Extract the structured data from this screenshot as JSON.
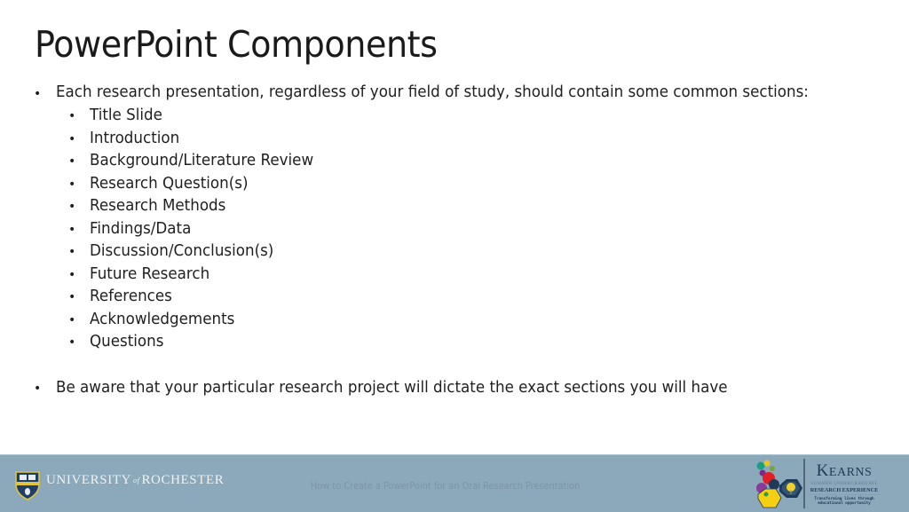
{
  "slide": {
    "title": "PowerPoint Components",
    "bullets": [
      {
        "level": 1,
        "text": "Each research presentation, regardless of your field of study, should contain some common sections:"
      },
      {
        "level": 2,
        "text": "Title Slide"
      },
      {
        "level": 2,
        "text": "Introduction"
      },
      {
        "level": 2,
        "text": "Background/Literature Review"
      },
      {
        "level": 2,
        "text": "Research Question(s)"
      },
      {
        "level": 2,
        "text": "Research Methods"
      },
      {
        "level": 2,
        "text": "Findings/Data"
      },
      {
        "level": 2,
        "text": "Discussion/Conclusion(s)"
      },
      {
        "level": 2,
        "text": "Future Research"
      },
      {
        "level": 2,
        "text": "References"
      },
      {
        "level": 2,
        "text": "Acknowledgements"
      },
      {
        "level": 2,
        "text": "Questions"
      },
      {
        "level": 1,
        "text": "Be aware that your particular research project will dictate the exact sections you will have"
      }
    ],
    "bullet_glyph": "•"
  },
  "footer": {
    "university_name_part1": "UNIVERSITY",
    "university_name_of": "of",
    "university_name_part2": "ROCHESTER",
    "presentation_title": "How to Create a PowerPoint for an Oral Research Presentation",
    "kearns": {
      "title_initial": "K",
      "title_rest": "EARNS",
      "subtitle1": "SUMMER UNDERGRADUATE",
      "subtitle2": "RESEARCH EXPERIENCE",
      "tagline1": "Transforming lives through",
      "tagline2": "educational opportunity"
    },
    "colors": {
      "bar": "#8ba9bb",
      "kearns_navy": "#1f3a56",
      "kearns_green": "#8fae5c"
    }
  }
}
